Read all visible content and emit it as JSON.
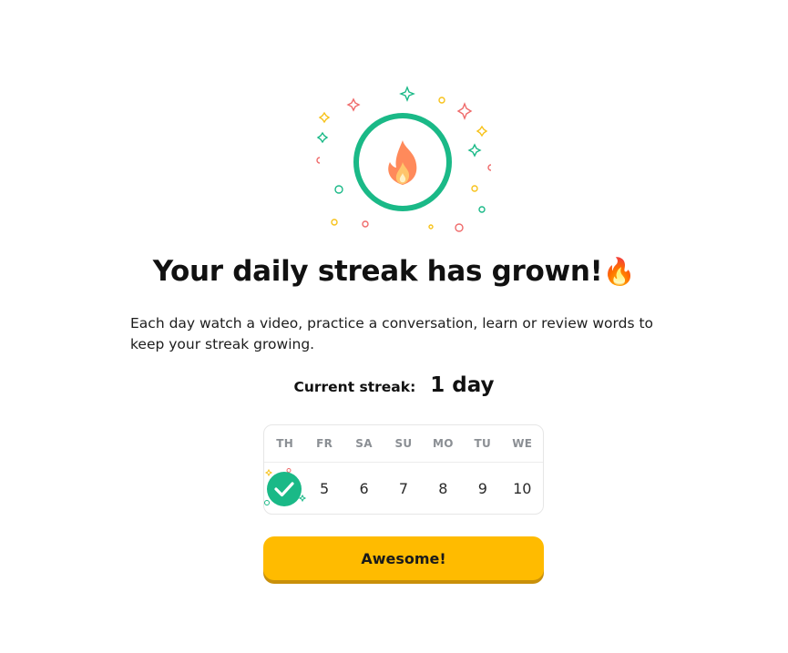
{
  "title": "Your daily streak has grown!",
  "title_emoji": "🔥",
  "description": "Each day watch a video, practice a conversation, learn or review words to keep your streak growing.",
  "streak": {
    "label": "Current streak:",
    "value": "1 day"
  },
  "calendar": {
    "days": [
      "TH",
      "FR",
      "SA",
      "SU",
      "MO",
      "TU",
      "WE"
    ],
    "dates": [
      "",
      "5",
      "6",
      "7",
      "8",
      "9",
      "10"
    ],
    "completed_day_index": 0
  },
  "button": {
    "label": "Awesome!"
  },
  "colors": {
    "accent_green": "#1ab987",
    "button_yellow": "#ffbb00",
    "flame_orange": "#ff8a5b",
    "sparkle_red": "#ef6b6b",
    "sparkle_yellow": "#f7c21a"
  },
  "icons": {
    "hero": "fire-icon",
    "completed": "check-icon"
  }
}
